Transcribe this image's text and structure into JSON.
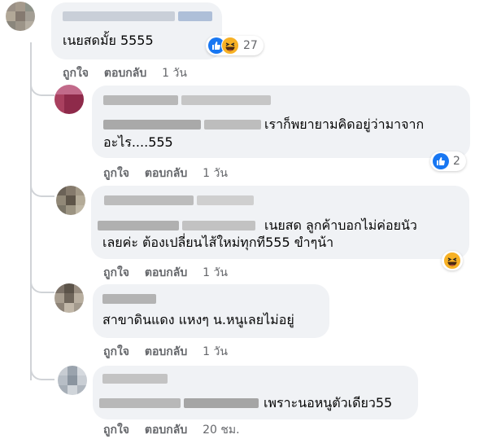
{
  "comments": [
    {
      "text_lines": [
        "เนยสดมั้ย 5555"
      ],
      "actions": {
        "like": "ถูกใจ",
        "reply": "ตอบกลับ",
        "time": "1 วัน"
      },
      "reactions": {
        "types": [
          "like-icon",
          "haha-icon"
        ],
        "count": "27"
      }
    },
    {
      "text_lines": [
        "เราก็พยายามคิดอยู่ว่ามาจาก",
        "อะไร....555"
      ],
      "actions": {
        "like": "ถูกใจ",
        "reply": "ตอบกลับ",
        "time": "1 วัน"
      },
      "reactions": {
        "types": [
          "like-icon"
        ],
        "count": "2"
      }
    },
    {
      "text_lines": [
        "เนยสด ลูกค้าบอกไม่ค่อยนัว",
        "เลยค่ะ ต้องเปลี่ยนไส้ใหม่ทุกที555 ขำๆน้า"
      ],
      "actions": {
        "like": "ถูกใจ",
        "reply": "ตอบกลับ",
        "time": "1 วัน"
      },
      "reactions": {
        "types": [
          "haha-icon"
        ],
        "count": ""
      }
    },
    {
      "text_lines": [
        "สาขาดินแดง แหงๆ น.หนูเลยไม่อยู่"
      ],
      "actions": {
        "like": "ถูกใจ",
        "reply": "ตอบกลับ",
        "time": "1 วัน"
      }
    },
    {
      "text_lines": [
        "เพราะนอหนูตัวเดียว55"
      ],
      "actions": {
        "like": "ถูกใจ",
        "reply": "ตอบกลับ",
        "time": "20 ชม."
      }
    }
  ],
  "colors": {
    "bubble": "#f0f2f5",
    "like_blue": "#1877f2",
    "haha_yellow": "#f7b125",
    "meta_gray": "#65676b",
    "thread_line": "#d0d3d7"
  }
}
